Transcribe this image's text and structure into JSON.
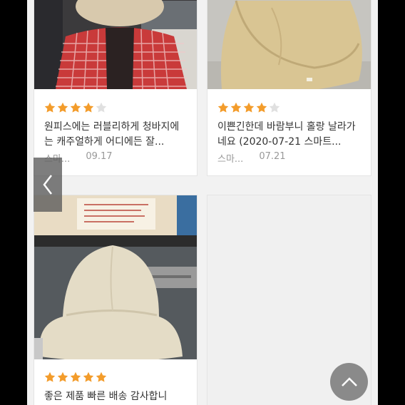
{
  "reviews": [
    {
      "text": "원피스에는 러블리하게 청바지에는 캐주얼하게 어디에든 잘...",
      "author": "스마...",
      "date": "09.17",
      "rating": 4
    },
    {
      "text": "이쁜긴한데 바람부니 홀랑 날라가네요 (2020-07-21 스마트...",
      "author": "스마...",
      "date": "07.21",
      "rating": 4
    },
    {
      "text": "좋은 제품 빠른 배송 감사합니",
      "author": "",
      "date": "",
      "rating": 5
    }
  ],
  "colors": {
    "star_filled": "#f39c2b",
    "star_empty": "#e0e0e0",
    "text": "#333333",
    "meta": "#999999"
  },
  "icons": {
    "prev": "chevron-left-icon",
    "scroll_top": "chevron-up-icon",
    "star": "star-icon"
  }
}
